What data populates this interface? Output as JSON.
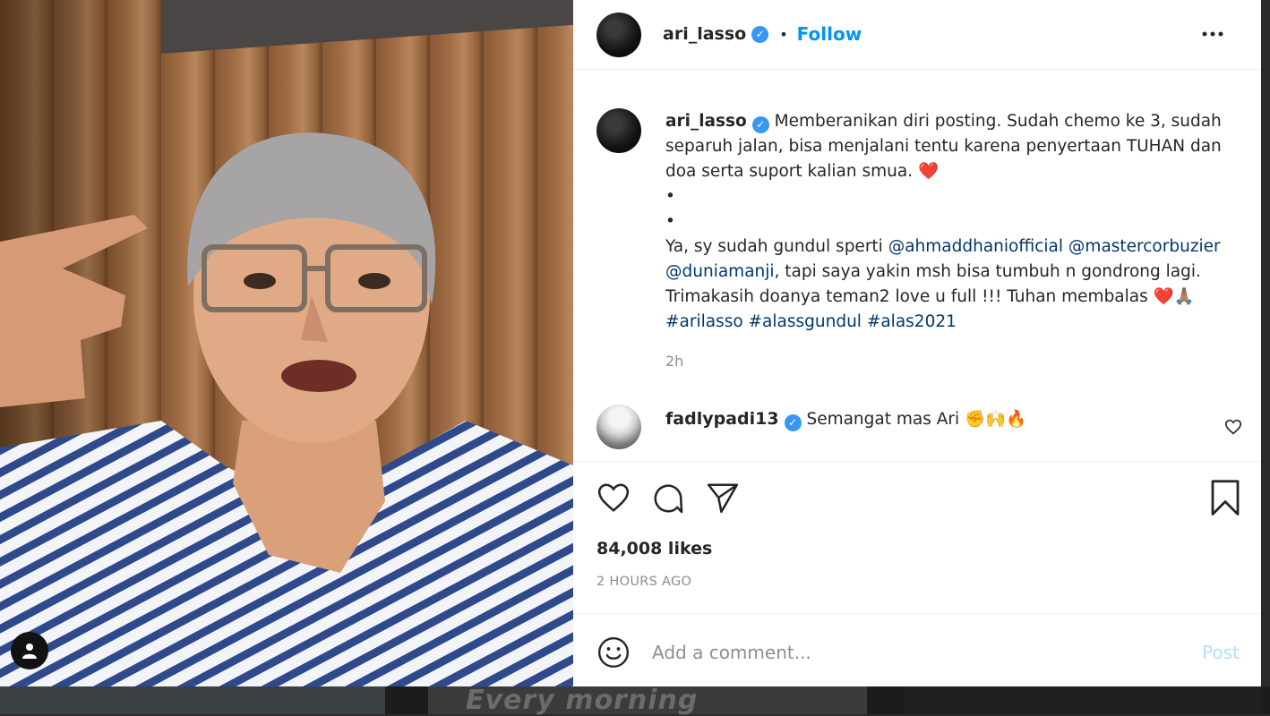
{
  "post": {
    "username": "ari_lasso",
    "verified_mark": "✓",
    "follow_label": "Follow",
    "more_icon": "more-options-icon"
  },
  "caption": {
    "username": "ari_lasso",
    "line1": "Memberanikan diri posting. Sudah chemo ke 3, sudah separuh jalan, bisa menjalani tentu karena penyertaan TUHAN dan doa serta suport kalian smua.",
    "heart": "❤️",
    "bullet1": "•",
    "bullet2": "•",
    "line2_prefix": "Ya, sy sudah gundul sperti",
    "mention1": "@ahmaddhaniofficial",
    "mention2": "@mastercorbuzier",
    "mention3": "@duniamanji",
    "line2_suffix": ", tapi saya yakin msh bisa tumbuh n gondrong lagi. Trimakasih doanya teman2 love u full !!! Tuhan membalas",
    "line2_emojis": "❤️🙏🏽",
    "hashtag1": "#arilasso",
    "hashtag2": "#alassgundul",
    "hashtag3": "#alas2021",
    "time": "2h"
  },
  "comment": {
    "username": "fadlypadi13",
    "text": "Semangat mas Ari",
    "emojis": "✊🙌🔥"
  },
  "actions": {
    "likes": "84,008 likes",
    "posted_ago": "2 HOURS AGO"
  },
  "add_comment": {
    "placeholder": "Add a comment...",
    "post_label": "Post"
  },
  "background": {
    "overlay_text": "Every morning"
  },
  "colors": {
    "link_blue": "#0095f6",
    "mention_blue": "#00376b",
    "verified_blue": "#3897f0",
    "post_disabled": "#b2dffc",
    "muted_gray": "#8e8e8e"
  }
}
